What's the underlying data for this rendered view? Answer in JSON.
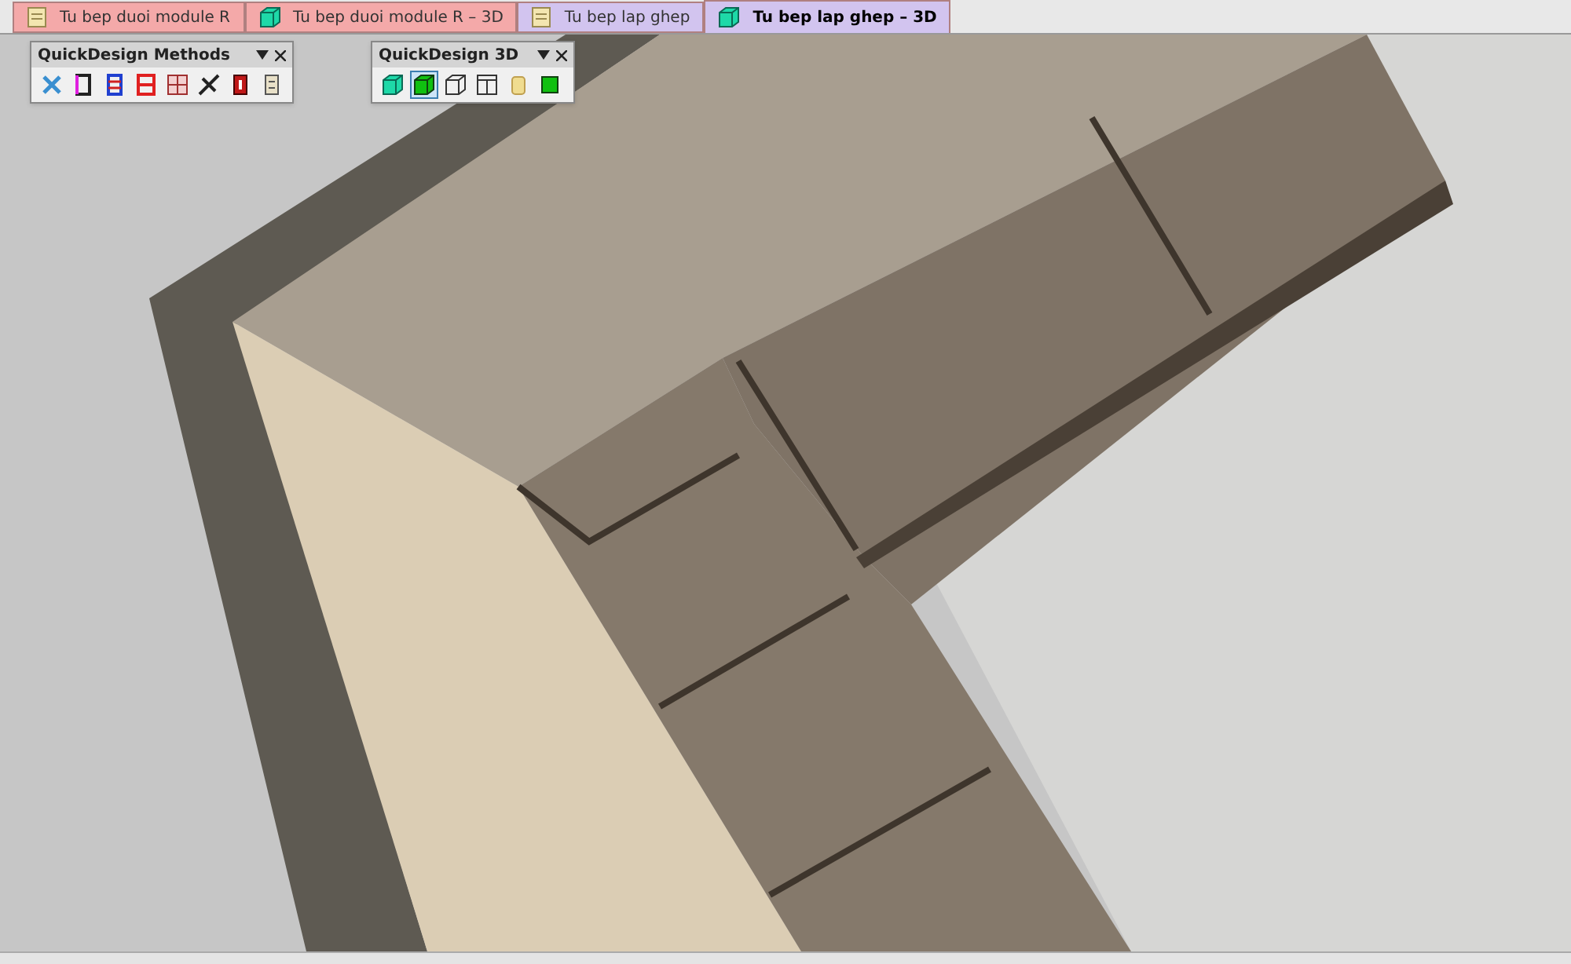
{
  "tabs": [
    {
      "label": "Tu bep duoi module R",
      "kind": "document",
      "color": "#f4a9a9",
      "selected": false
    },
    {
      "label": "Tu bep duoi module R – 3D",
      "kind": "cube",
      "color": "#f4a9a9",
      "selected": false
    },
    {
      "label": "Tu bep lap ghep",
      "kind": "document",
      "color": "#d2c4ef",
      "selected": false
    },
    {
      "label": "Tu bep lap ghep – 3D",
      "kind": "cube",
      "color": "#d2c4ef",
      "selected": true
    }
  ],
  "toolbars": [
    {
      "title": "QuickDesign Methods",
      "tools": [
        {
          "kind": "tools",
          "selected": false
        },
        {
          "kind": "panel-magenta",
          "selected": false
        },
        {
          "kind": "shelves-blue",
          "selected": false
        },
        {
          "kind": "shelves-red",
          "selected": false
        },
        {
          "kind": "grid",
          "selected": false
        },
        {
          "kind": "connector",
          "selected": false
        },
        {
          "kind": "door-red",
          "selected": false
        },
        {
          "kind": "drawer",
          "selected": false
        }
      ]
    },
    {
      "title": "QuickDesign 3D",
      "tools": [
        {
          "kind": "cube-cyan",
          "selected": false
        },
        {
          "kind": "cube-green",
          "selected": true
        },
        {
          "kind": "wire-cube",
          "selected": false
        },
        {
          "kind": "front-view",
          "selected": false
        },
        {
          "kind": "cylinder",
          "selected": false
        },
        {
          "kind": "solid-green",
          "selected": false
        }
      ]
    }
  ]
}
